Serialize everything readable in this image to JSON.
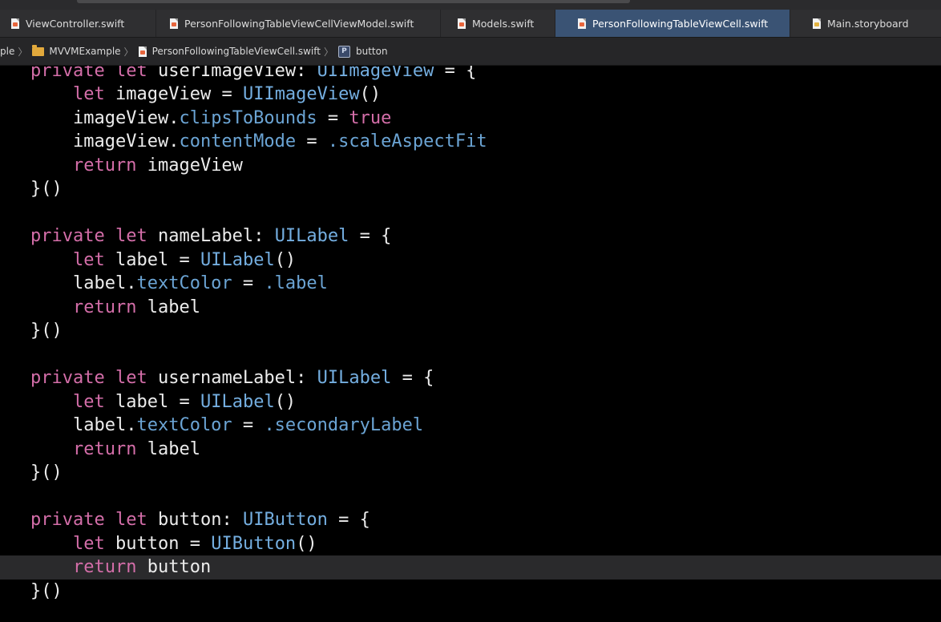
{
  "tabs": [
    {
      "label": "ViewController.swift",
      "icon": "swift-file-icon",
      "active": false
    },
    {
      "label": "PersonFollowingTableViewCellViewModel.swift",
      "icon": "swift-file-icon",
      "active": false
    },
    {
      "label": "Models.swift",
      "icon": "swift-file-icon",
      "active": false
    },
    {
      "label": "PersonFollowingTableViewCell.swift",
      "icon": "swift-file-icon",
      "active": true
    },
    {
      "label": "Main.storyboard",
      "icon": "storyboard-file-icon",
      "active": false
    }
  ],
  "breadcrumb": {
    "project_fragment": "ple",
    "group": "MVVMExample",
    "file": "PersonFollowingTableViewCell.swift",
    "symbol_badge": "P",
    "symbol": "button"
  },
  "code": {
    "l1": {
      "kw1": "private",
      "kw2": "let",
      "name": "userImageView",
      "colon": ":",
      "type": "UIImageView",
      "rest": " = {"
    },
    "l2": {
      "kw": "let",
      "name": "imageView",
      "eq": " = ",
      "type": "UIImageView",
      "rest": "()"
    },
    "l3": {
      "obj": "imageView",
      "dot": ".",
      "prop": "clipsToBounds",
      "eq": " = ",
      "val": "true"
    },
    "l4": {
      "obj": "imageView",
      "dot": ".",
      "prop": "contentMode",
      "eq": " = ",
      "val": ".scaleAspectFit"
    },
    "l5": {
      "kw": "return",
      "name": "imageView"
    },
    "l6": "}()",
    "l8": {
      "kw1": "private",
      "kw2": "let",
      "name": "nameLabel",
      "colon": ":",
      "type": "UILabel",
      "rest": " = {"
    },
    "l9": {
      "kw": "let",
      "name": "label",
      "eq": " = ",
      "type": "UILabel",
      "rest": "()"
    },
    "l10": {
      "obj": "label",
      "dot": ".",
      "prop": "textColor",
      "eq": " = ",
      "val": ".label"
    },
    "l11": {
      "kw": "return",
      "name": "label"
    },
    "l12": "}()",
    "l14": {
      "kw1": "private",
      "kw2": "let",
      "name": "usernameLabel",
      "colon": ":",
      "type": "UILabel",
      "rest": " = {"
    },
    "l15": {
      "kw": "let",
      "name": "label",
      "eq": " = ",
      "type": "UILabel",
      "rest": "()"
    },
    "l16": {
      "obj": "label",
      "dot": ".",
      "prop": "textColor",
      "eq": " = ",
      "val": ".secondaryLabel"
    },
    "l17": {
      "kw": "return",
      "name": "label"
    },
    "l18": "}()",
    "l20": {
      "kw1": "private",
      "kw2": "let",
      "name": "button",
      "colon": ":",
      "type": "UIButton",
      "rest": " = {"
    },
    "l21": {
      "kw": "let",
      "name": "button",
      "eq": " = ",
      "type": "UIButton",
      "rest": "()"
    },
    "l22": {
      "kw": "return",
      "name": "button"
    },
    "l23": "}()"
  },
  "colors": {
    "keyword": "#d46ea9",
    "type": "#74aee0",
    "property": "#6ba4d4",
    "plain": "#ececec",
    "active_tab": "#3a5374",
    "current_line": "#2a2a2c"
  }
}
